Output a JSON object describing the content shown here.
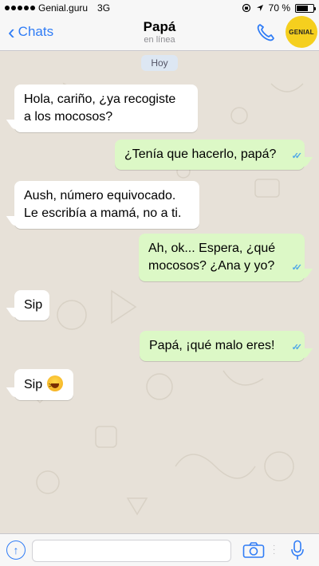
{
  "status_bar": {
    "carrier": "Genial.guru",
    "network": "3G",
    "battery": "70 %",
    "battery_level": 0.7
  },
  "header": {
    "back_label": "Chats",
    "title": "Papá",
    "subtitle": "en línea",
    "badge": "GENIAL"
  },
  "chat": {
    "day_label": "Hoy",
    "messages": [
      {
        "side": "in",
        "text_line1": "Hola, cariño, ¿ya recogiste",
        "text_line2": "a los mocosos?"
      },
      {
        "side": "out",
        "text": "¿Tenía que hacerlo, papá?"
      },
      {
        "side": "in",
        "text_line1": "Aush, número equivocado.",
        "text_line2": "Le escribía a mamá, no a ti."
      },
      {
        "side": "out",
        "text_line1": "Ah, ok... Espera, ¿qué",
        "text_line2": "mocosos? ¿Ana y yo?"
      },
      {
        "side": "in",
        "text": "Sip"
      },
      {
        "side": "out",
        "text": "Papá, ¡qué malo eres!"
      },
      {
        "side": "in",
        "text": "Sip",
        "emoji": "laughing-emoji"
      }
    ]
  },
  "input_bar": {
    "placeholder": ""
  },
  "colors": {
    "accent": "#2f7cf6",
    "outgoing_bubble": "#dcf8c6",
    "incoming_bubble": "#ffffff",
    "wallpaper": "#e7e1d8",
    "read_ticks": "#4fa7e8",
    "badge": "#f5cf1e"
  }
}
